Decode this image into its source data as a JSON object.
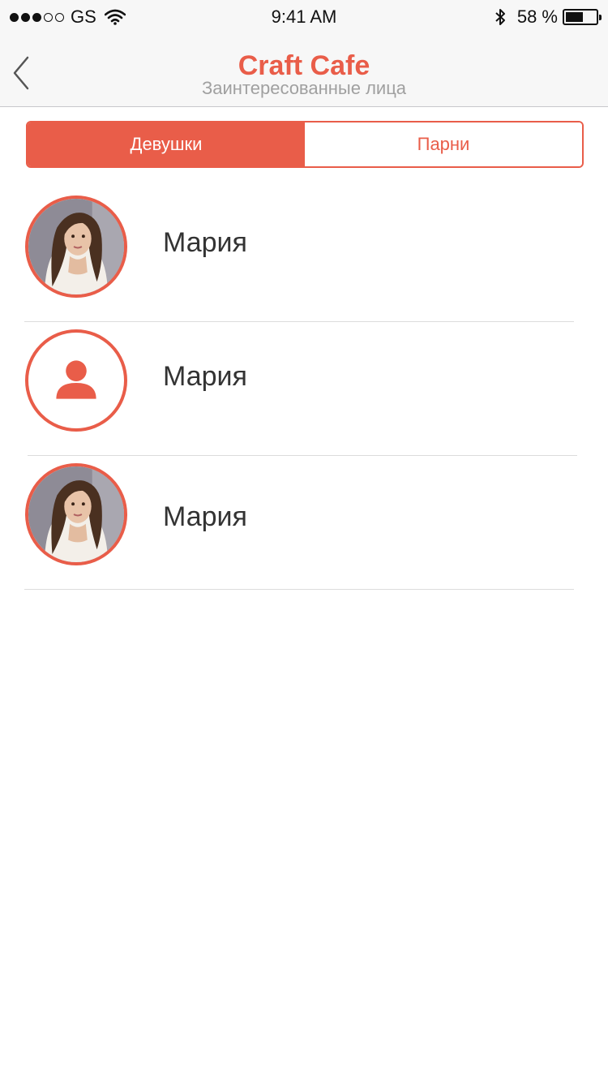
{
  "status_bar": {
    "carrier": "GS",
    "signal_bars_filled": 3,
    "signal_bars_total": 5,
    "time": "9:41 AM",
    "battery_percent_text": "58 %",
    "battery_level": 0.58,
    "icons": [
      "wifi-icon",
      "bluetooth-icon",
      "battery-icon"
    ]
  },
  "nav": {
    "back_icon": "chevron-left-icon",
    "title": "Craft Cafe",
    "subtitle": "Заинтересованные лица"
  },
  "segments": [
    {
      "label": "Девушки",
      "selected": true
    },
    {
      "label": "Парни",
      "selected": false
    }
  ],
  "people": [
    {
      "name": "Мария",
      "avatar": "photo"
    },
    {
      "name": "Мария",
      "avatar": "person-placeholder-icon"
    },
    {
      "name": "Мария",
      "avatar": "photo"
    }
  ],
  "colors": {
    "accent": "#e95d49",
    "subtitle": "#a0a0a0",
    "bar_background": "#f7f7f7",
    "text": "#333333"
  }
}
